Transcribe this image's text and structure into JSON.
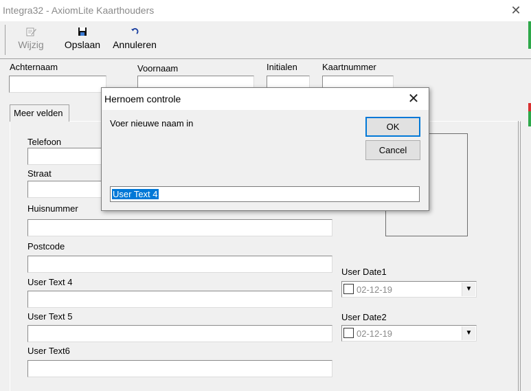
{
  "window": {
    "title": "Integra32 - AxiomLite Kaarthouders",
    "close_glyph": "✕"
  },
  "toolbar": {
    "edit": {
      "label": "Wijzig",
      "icon": "pencil-icon",
      "enabled": false
    },
    "save": {
      "label": "Opslaan",
      "icon": "floppy-disk-icon"
    },
    "cancel": {
      "label": "Annuleren",
      "icon": "undo-icon"
    }
  },
  "header_fields": {
    "achternaam": {
      "label": "Achternaam",
      "value": ""
    },
    "voornaam": {
      "label": "Voornaam",
      "value": ""
    },
    "initialen": {
      "label": "Initialen",
      "value": ""
    },
    "kaartnummer": {
      "label": "Kaartnummer",
      "value": ""
    }
  },
  "tabs": [
    {
      "label": "Meer velden",
      "active": true
    }
  ],
  "form": {
    "telefoon": {
      "label": "Telefoon",
      "value": ""
    },
    "straat": {
      "label": "Straat",
      "value": ""
    },
    "huisnummer": {
      "label": "Huisnummer",
      "value": ""
    },
    "postcode": {
      "label": "Postcode",
      "value": ""
    },
    "user_text_4": {
      "label": "User Text 4",
      "value": ""
    },
    "user_text_5": {
      "label": "User Text 5",
      "value": ""
    },
    "user_text_6": {
      "label": "User Text6",
      "value": ""
    },
    "user_date_1": {
      "label": "User Date1",
      "value": "02-12-19",
      "checked": false
    },
    "user_date_2": {
      "label": "User Date2",
      "value": "02-12-19",
      "checked": false
    }
  },
  "dialog": {
    "title": "Hernoem controle",
    "prompt": "Voer nieuwe naam in",
    "ok_label": "OK",
    "cancel_label": "Cancel",
    "input_value": "User Text 4",
    "close_glyph": "✕"
  },
  "colors": {
    "selection": "#0078d7",
    "default_button_border": "#0078d7",
    "background": "#f0f0f0"
  }
}
